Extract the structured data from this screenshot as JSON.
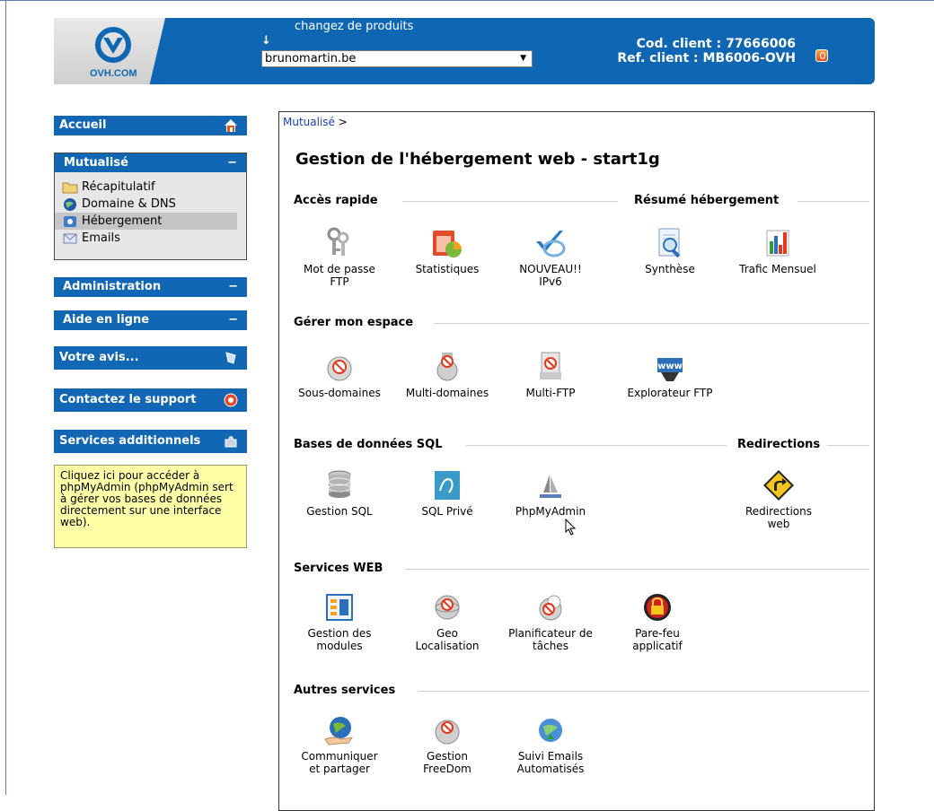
{
  "header": {
    "logo_text": "OVH.COM",
    "change_products_label": "changez de produits",
    "domain_selected": "brunomartin.be",
    "client_code": "Cod. client : 77666006",
    "client_ref": "Ref. client : MB6006-OVH"
  },
  "sidebar": {
    "accueil": "Accueil",
    "mutualise": "Mutualisé",
    "mutualise_toggle": "−",
    "mutualise_items": [
      "Récapitulatif",
      "Domaine & DNS",
      "Hébergement",
      "Emails"
    ],
    "administration": "Administration",
    "administration_toggle": "−",
    "aide": "Aide en ligne",
    "aide_toggle": "−",
    "avis": "Votre avis...",
    "support": "Contactez le support",
    "services": "Services additionnels",
    "tip": "Cliquez ici pour accéder à phpMyAdmin (phpMyAdmin sert à gérer vos bases de données directement sur une interface web)."
  },
  "main": {
    "breadcrumb_link": "Mutualisé",
    "breadcrumb_sep": ">",
    "title": "Gestion de l'hébergement web - start1g",
    "sections": {
      "acces_rapide": "Accès rapide",
      "resume": "Résumé hébergement",
      "gerer": "Gérer mon espace",
      "bases": "Bases de données SQL",
      "redirections": "Redirections",
      "services_web": "Services WEB",
      "autres": "Autres services"
    },
    "tiles": {
      "mdp_ftp": "Mot de passe FTP",
      "statistiques": "Statistiques",
      "ipv6": "NOUVEAU!! IPv6",
      "synthese": "Synthèse",
      "trafic": "Trafic Mensuel",
      "sous_domaines": "Sous-domaines",
      "multi_domaines": "Multi-domaines",
      "multi_ftp": "Multi-FTP",
      "explorateur": "Explorateur FTP",
      "gestion_sql": "Gestion SQL",
      "sql_prive": "SQL Privé",
      "phpmyadmin": "PhpMyAdmin",
      "redirections_web": "Redirections web",
      "gestion_modules": "Gestion des modules",
      "geo": "Geo Localisation",
      "planificateur": "Planificateur de tâches",
      "parefeu": "Pare-feu applicatif",
      "communiquer": "Communiquer et partager",
      "freedom": "Gestion FreeDom",
      "suivi_emails": "Suivi Emails Automatisés"
    },
    "www_label": "www"
  },
  "colors": {
    "brand_blue": "#0f66b2",
    "tip_yellow": "#ffffa8",
    "link_blue": "#1a3fb0"
  },
  "icons": [
    "ovh-logo-icon",
    "home-icon",
    "folder-icon",
    "globe-icon",
    "server-icon",
    "email-icon",
    "feedback-icon",
    "support-icon",
    "puzzle-icon",
    "logout-icon"
  ]
}
